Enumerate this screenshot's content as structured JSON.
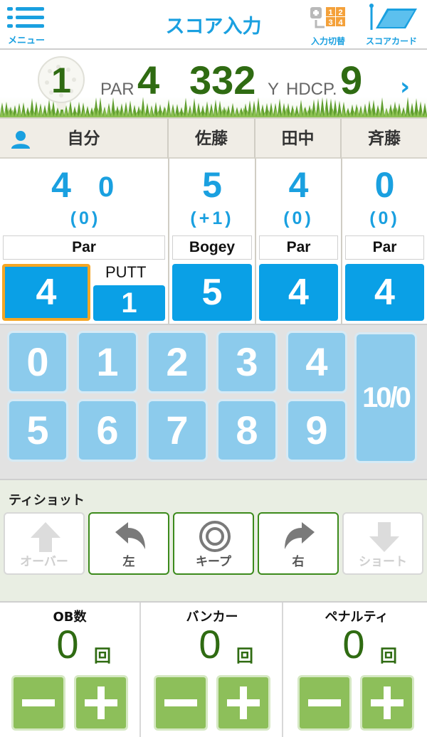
{
  "header": {
    "menu_label": "メニュー",
    "title": "スコア入力",
    "switch_label": "入力切替",
    "switch_digits": [
      "1",
      "2",
      "3",
      "4"
    ],
    "card_label": "スコアカード"
  },
  "hole": {
    "number": "1",
    "par_label": "PAR",
    "par": "4",
    "yards": "332",
    "yard_unit": "Y",
    "hdcp_label": "HDCP.",
    "hdcp": "9",
    "next": "›"
  },
  "players": [
    {
      "name": "自分",
      "score": "4",
      "putts": "0",
      "diff": "(0)",
      "result": "Par",
      "stroke": "4",
      "putt_stroke": "1"
    },
    {
      "name": "佐藤",
      "score": "5",
      "diff": "(+1)",
      "result": "Bogey",
      "stroke": "5"
    },
    {
      "name": "田中",
      "score": "4",
      "diff": "(0)",
      "result": "Par",
      "stroke": "4"
    },
    {
      "name": "斉藤",
      "score": "0",
      "diff": "(0)",
      "result": "Par",
      "stroke": "4"
    }
  ],
  "putt_label": "PUTT",
  "keypad": {
    "keys": [
      "0",
      "1",
      "2",
      "3",
      "4",
      "5",
      "6",
      "7",
      "8",
      "9"
    ],
    "ten_key": "10/0"
  },
  "tee_shot": {
    "title": "ティショット",
    "buttons": [
      {
        "label": "オーバー",
        "icon": "arrow-up-icon",
        "enabled": false
      },
      {
        "label": "左",
        "icon": "arrow-left-curve-icon",
        "enabled": true
      },
      {
        "label": "キープ",
        "icon": "target-ring-icon",
        "enabled": true
      },
      {
        "label": "右",
        "icon": "arrow-right-curve-icon",
        "enabled": true
      },
      {
        "label": "ショート",
        "icon": "arrow-down-icon",
        "enabled": false
      }
    ]
  },
  "counters": [
    {
      "label": "OB数",
      "value": "0",
      "unit": "回"
    },
    {
      "label": "バンカー",
      "value": "0",
      "unit": "回"
    },
    {
      "label": "ペナルティ",
      "value": "0",
      "unit": "回"
    }
  ],
  "colors": {
    "accent": "#1aa0e0",
    "score_button": "#0aa0e6",
    "key": "#8ccbec",
    "green_text": "#2f6b12",
    "counter_button": "#8dbf5a",
    "selected_border": "#f5a623"
  }
}
